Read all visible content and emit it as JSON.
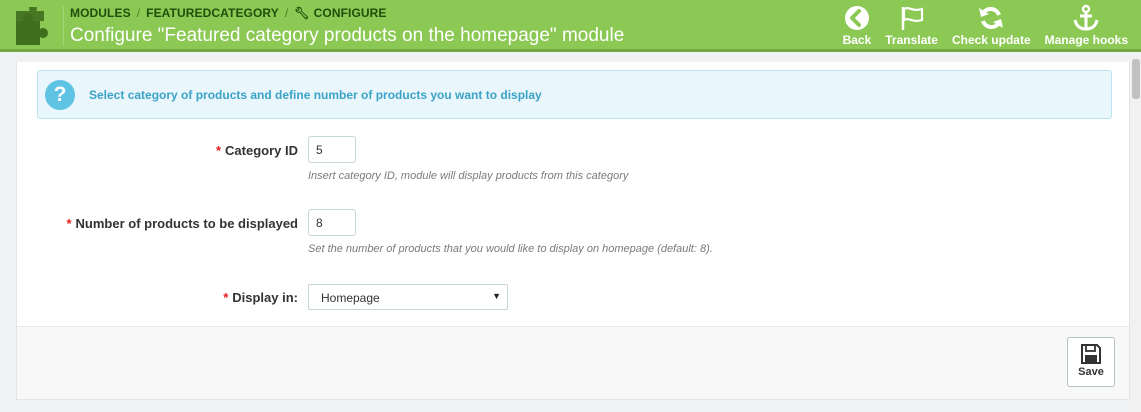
{
  "breadcrumb": [
    "MODULES",
    "FEATUREDCATEGORY",
    "CONFIGURE"
  ],
  "title": "Configure \"Featured category products on the homepage\" module",
  "toolbar": {
    "back": "Back",
    "translate": "Translate",
    "check_update": "Check update",
    "manage_hooks": "Manage hooks"
  },
  "alert": {
    "icon": "question-icon",
    "text": "Select category of products and define number of products you want to display"
  },
  "form": {
    "category": {
      "required": "*",
      "label": "Category ID",
      "value": "5",
      "help": "Insert category ID, module will display products from this category"
    },
    "count": {
      "required": "*",
      "label": "Number of products to be displayed",
      "value": "8",
      "help": "Set the number of products that you would like to display on homepage (default: 8)."
    },
    "display": {
      "required": "*",
      "label": "Display in:",
      "value": "Homepage"
    }
  },
  "footer": {
    "save_label": "Save"
  },
  "colors": {
    "header": "#8bc954",
    "alert_bg": "#e9f6fb",
    "alert_text": "#3ba3c8",
    "required": "#e31e1e"
  }
}
